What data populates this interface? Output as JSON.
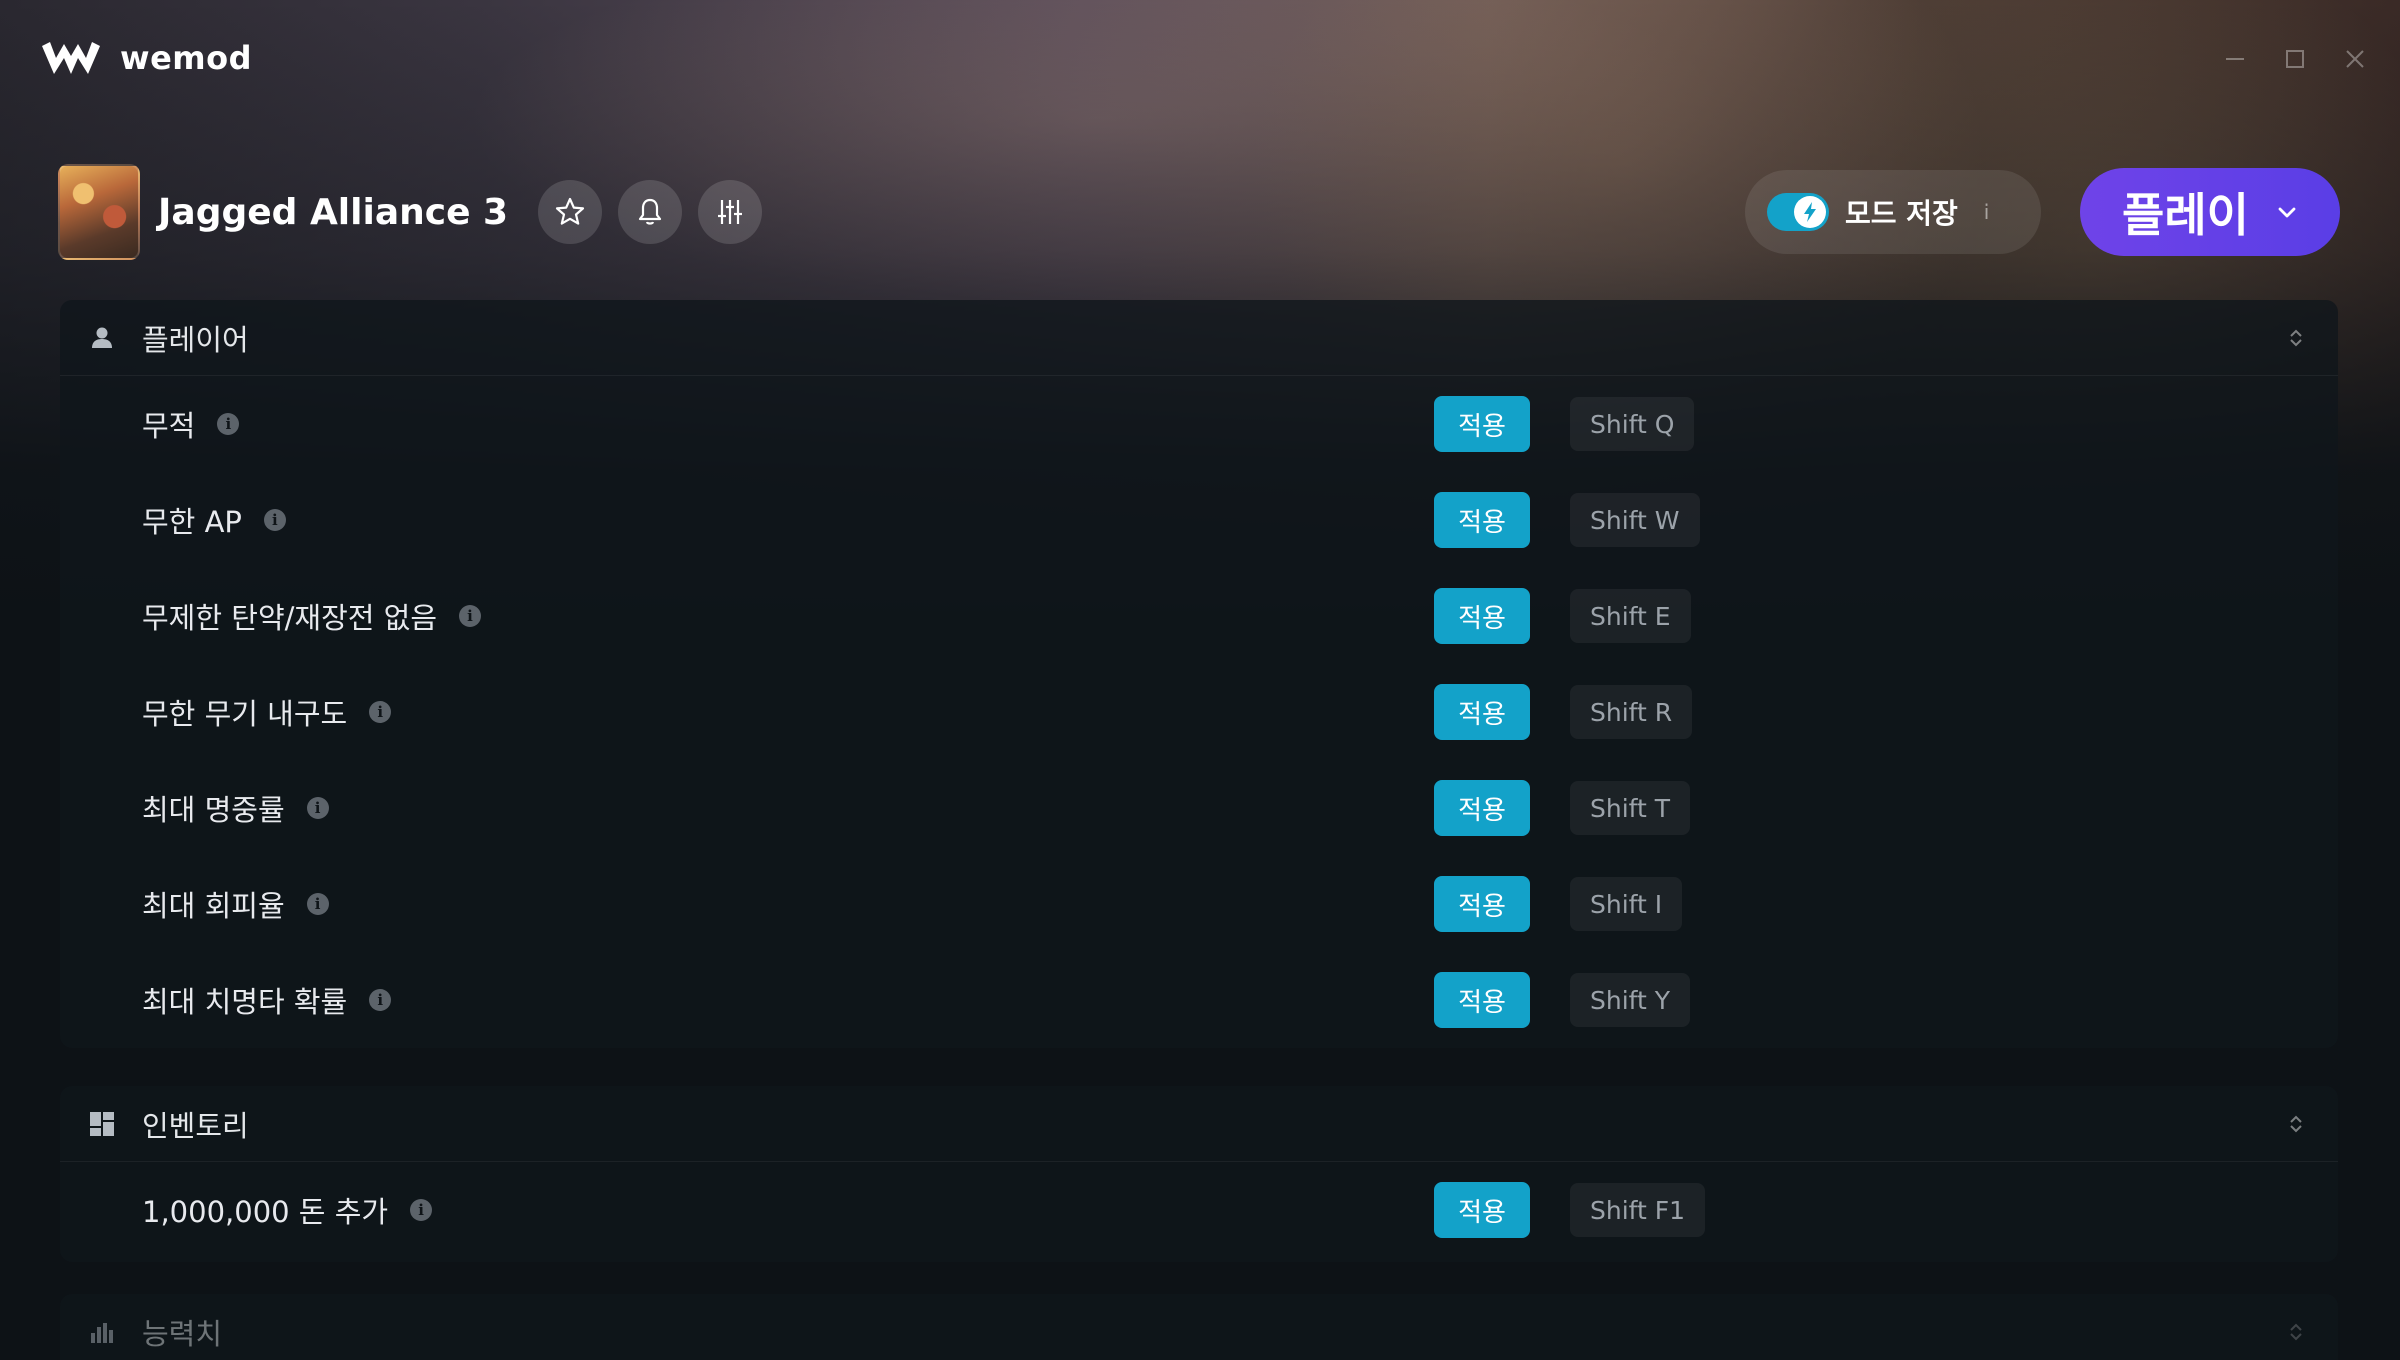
{
  "app": {
    "brand_name": "wemod"
  },
  "game": {
    "title": "Jagged Alliance 3"
  },
  "mod_save": {
    "label": "모드 저장",
    "info": "i",
    "enabled": true
  },
  "play_button": {
    "label": "플레이"
  },
  "colors": {
    "accent": "#13a2c9",
    "play": "#5a3ee6"
  },
  "sections": {
    "player": {
      "title": "플레이어",
      "icon": "person-icon",
      "mods": [
        {
          "name": "무적",
          "apply": "적용",
          "hotkey": "Shift Q"
        },
        {
          "name": "무한 AP",
          "apply": "적용",
          "hotkey": "Shift W"
        },
        {
          "name": "무제한 탄약/재장전 없음",
          "apply": "적용",
          "hotkey": "Shift E"
        },
        {
          "name": "무한 무기 내구도",
          "apply": "적용",
          "hotkey": "Shift R"
        },
        {
          "name": "최대 명중률",
          "apply": "적용",
          "hotkey": "Shift T"
        },
        {
          "name": "최대 회피율",
          "apply": "적용",
          "hotkey": "Shift I"
        },
        {
          "name": "최대 치명타 확률",
          "apply": "적용",
          "hotkey": "Shift Y"
        }
      ]
    },
    "inventory": {
      "title": "인벤토리",
      "icon": "grid-icon",
      "mods": [
        {
          "name": "1,000,000 돈 추가",
          "apply": "적용",
          "hotkey": "Shift F1"
        }
      ]
    },
    "stats": {
      "title": "능력치",
      "icon": "bar-chart-icon"
    }
  }
}
